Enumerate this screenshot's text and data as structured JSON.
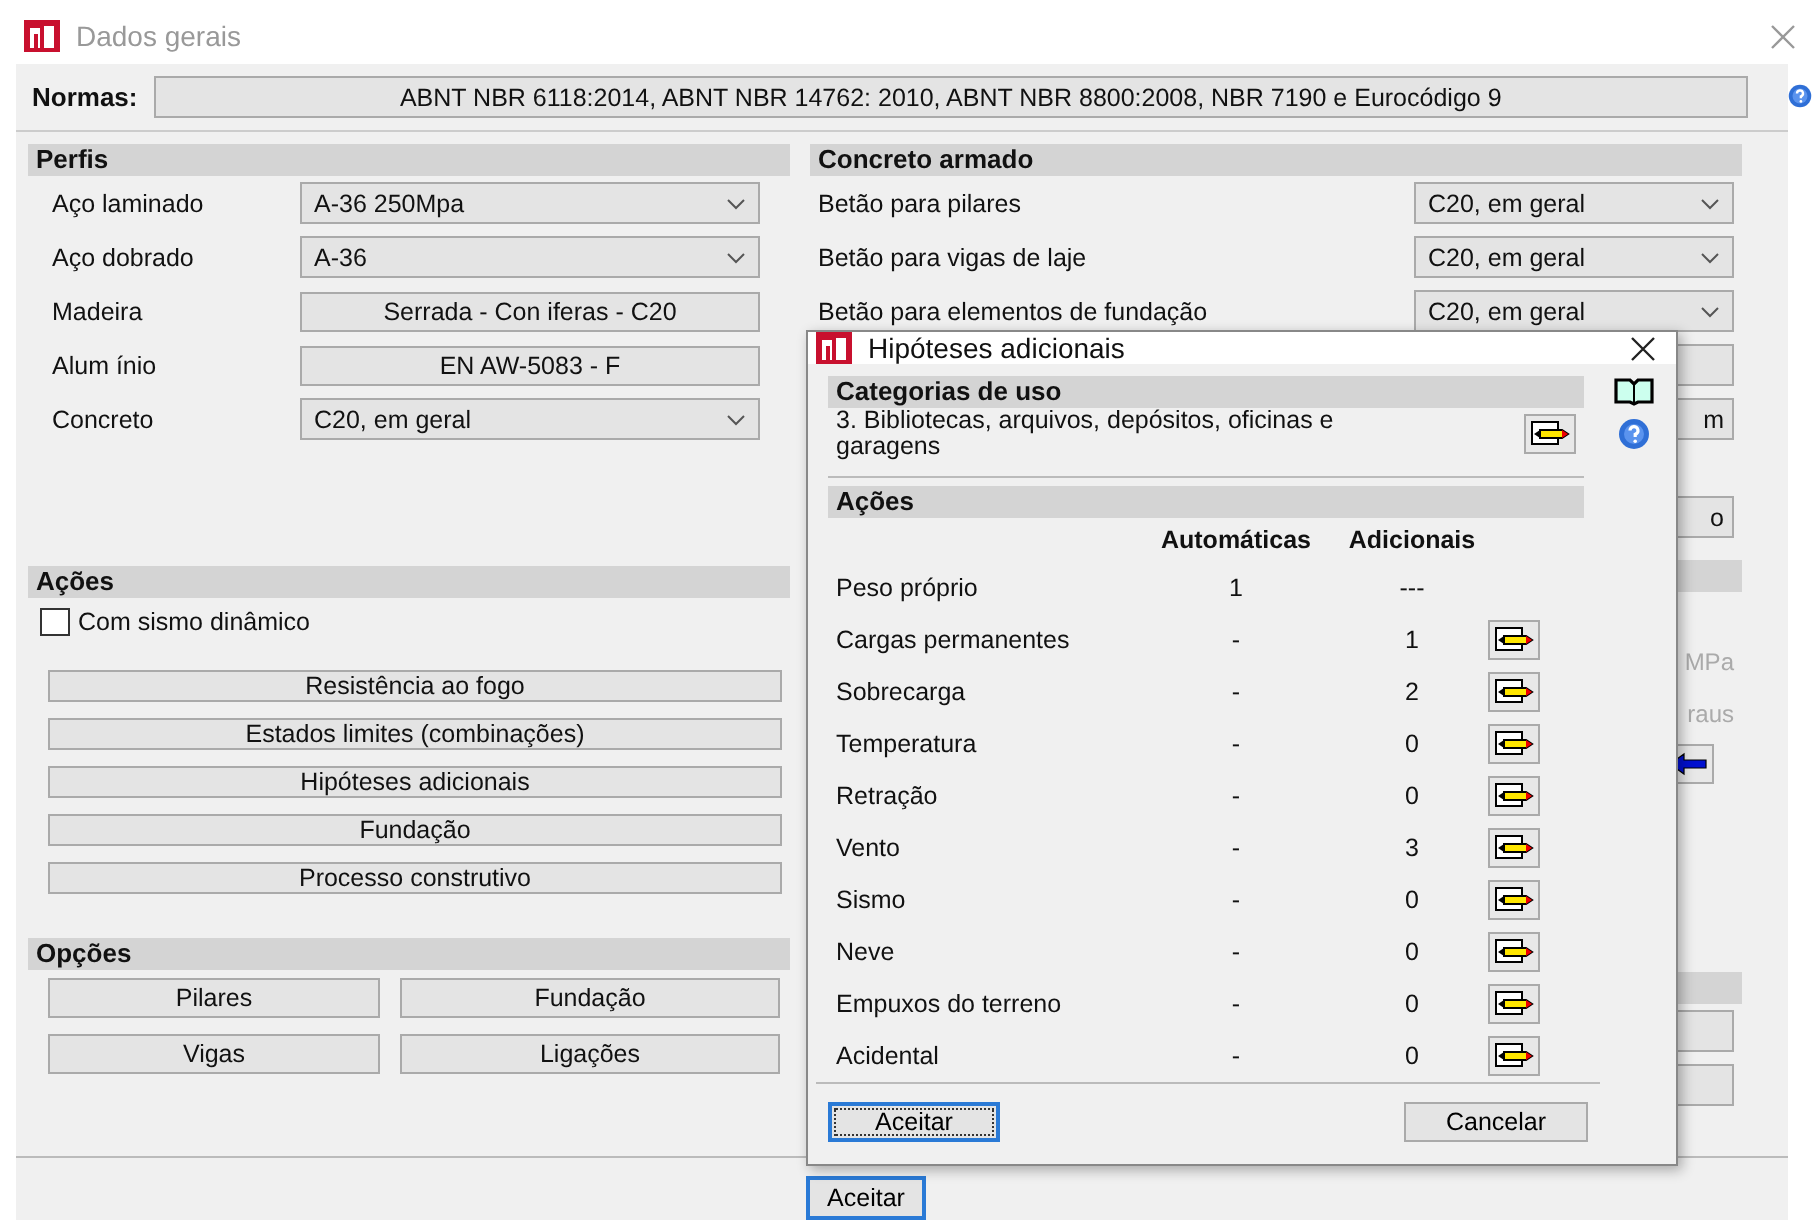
{
  "window": {
    "title": "Dados gerais"
  },
  "normas": {
    "label": "Normas:",
    "value": "ABNT NBR 6118:2014, ABNT NBR 14762: 2010, ABNT NBR 8800:2008, NBR 7190 e Eurocódigo 9"
  },
  "perfis": {
    "title": "Perfis",
    "rows": [
      {
        "label": "Aço laminado",
        "kind": "dropdown",
        "value": "A-36 250Mpa"
      },
      {
        "label": "Aço dobrado",
        "kind": "dropdown",
        "value": "A-36"
      },
      {
        "label": "Madeira",
        "kind": "button",
        "value": "Serrada - Con iferas - C20"
      },
      {
        "label": "Alum ínio",
        "kind": "button",
        "value": "EN AW-5083 - F"
      },
      {
        "label": "Concreto",
        "kind": "dropdown",
        "value": "C20, em geral"
      }
    ]
  },
  "acoes": {
    "title": "Ações",
    "checkbox": {
      "label": "Com sismo dinâmico",
      "checked": false
    },
    "buttons": [
      "Resistência ao fogo",
      "Estados limites (combinações)",
      "Hipóteses adicionais",
      "Fundação",
      "Processo construtivo"
    ]
  },
  "opcoes": {
    "title": "Opções",
    "buttons": [
      "Pilares",
      "Fundação",
      "Vigas",
      "Ligações"
    ]
  },
  "concreto": {
    "title": "Concreto armado",
    "rows": [
      {
        "label": "Betão para pilares",
        "value": "C20, em geral"
      },
      {
        "label": "Betão para vigas de laje",
        "value": "C20, em geral"
      },
      {
        "label": "Betão para elementos de fundação",
        "value": "C20, em geral"
      }
    ],
    "partial": [
      "m",
      "o"
    ],
    "partial_texts": [
      "MPa",
      "raus"
    ]
  },
  "footer": {
    "accept": "Aceitar"
  },
  "dialog": {
    "title": "Hipóteses adicionais",
    "categorias": {
      "title": "Categorias de uso",
      "value": "3. Bibliotecas, arquivos, depósitos, oficinas e garagens"
    },
    "acoes": {
      "title": "Ações",
      "columns": [
        "Automáticas",
        "Adicionais"
      ],
      "rows": [
        {
          "name": "Peso próprio",
          "auto": "1",
          "extra": "---",
          "editable": false
        },
        {
          "name": "Cargas permanentes",
          "auto": "-",
          "extra": "1",
          "editable": true
        },
        {
          "name": "Sobrecarga",
          "auto": "-",
          "extra": "2",
          "editable": true
        },
        {
          "name": "Temperatura",
          "auto": "-",
          "extra": "0",
          "editable": true
        },
        {
          "name": "Retração",
          "auto": "-",
          "extra": "0",
          "editable": true
        },
        {
          "name": "Vento",
          "auto": "-",
          "extra": "3",
          "editable": true
        },
        {
          "name": "Sismo",
          "auto": "-",
          "extra": "0",
          "editable": true
        },
        {
          "name": "Neve",
          "auto": "-",
          "extra": "0",
          "editable": true
        },
        {
          "name": "Empuxos do terreno",
          "auto": "-",
          "extra": "0",
          "editable": true
        },
        {
          "name": "Acidental",
          "auto": "-",
          "extra": "0",
          "editable": true
        }
      ]
    },
    "buttons": {
      "accept": "Aceitar",
      "cancel": "Cancelar"
    }
  }
}
